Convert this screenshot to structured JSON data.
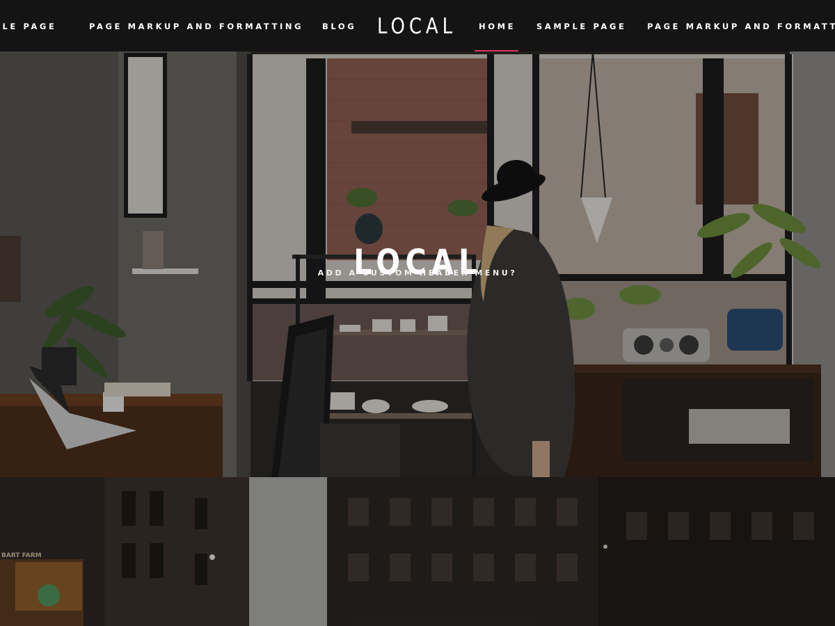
{
  "nav": {
    "left_items": [
      {
        "label": "SAMPLE PAGE"
      },
      {
        "label": "PAGE MARKUP AND FORMATTING"
      },
      {
        "label": "BLOG"
      }
    ],
    "logo": "LOCAL",
    "right_items": [
      {
        "label": "HOME",
        "active": true
      },
      {
        "label": "SAMPLE PAGE"
      },
      {
        "label": "PAGE MARKUP AND FORMATTING"
      }
    ],
    "active_color": "#e0345e"
  },
  "hero": {
    "title": "LOCAL",
    "subtitle": "ADD A CUSTOM HEADER MENU?"
  },
  "street_sign": "BART FARM"
}
